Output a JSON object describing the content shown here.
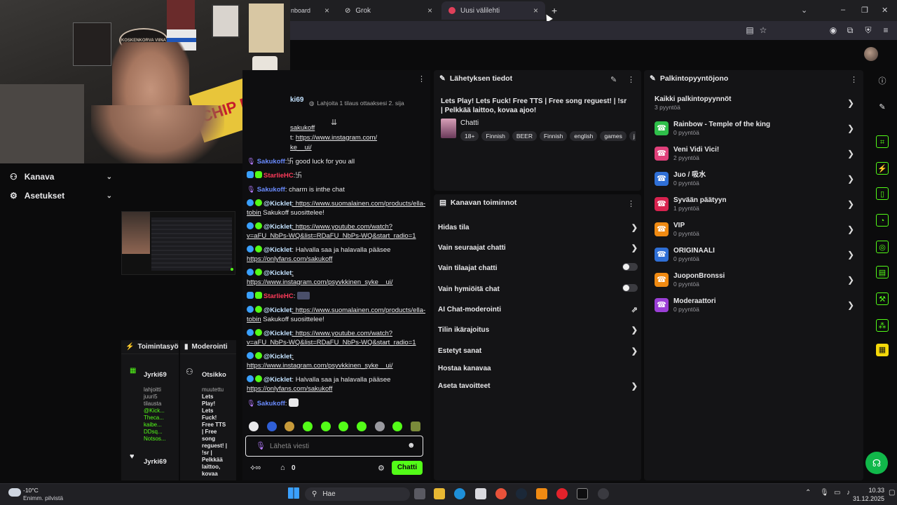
{
  "browser": {
    "tabs": [
      {
        "label": "nboard",
        "close": "×"
      },
      {
        "label": "Grok",
        "close": "×"
      },
      {
        "label": "Uusi välilehti",
        "close": "×"
      }
    ],
    "new_tab": "+"
  },
  "webcam": {
    "poster_text": "KOSKENKORVA VIINA",
    "sign_text": "CHIP DIP"
  },
  "nav": {
    "items": [
      {
        "label": "Kanava",
        "icon": "users-icon"
      },
      {
        "label": "Asetukset",
        "icon": "gear-icon"
      }
    ]
  },
  "panels": {
    "activity": {
      "title": "Toimintasyöte",
      "user": "Jyrki69",
      "lines": [
        "lahjoitti",
        "juuri5",
        "tilausta"
      ],
      "names": [
        "@Kick...",
        "Theca...",
        "kaibe...",
        "DDsq...",
        "Notsos..."
      ],
      "user2": "Jyrki69"
    },
    "moderation": {
      "title": "Moderointi",
      "header": "Otsikko",
      "changed": "muutettu",
      "title_lines": [
        "Lets",
        "Play!",
        "Lets",
        "Fuck!",
        "Free TTS",
        "| Free",
        "song",
        "reguest! |",
        "!sr |",
        "Pelkkää",
        "laittoo,",
        "kovaa"
      ]
    }
  },
  "chat": {
    "top_user": "ki69",
    "gift_hint": "Lahjoita 1 tilaus ottaaksesi 2. sija",
    "messages": [
      {
        "user": "",
        "text": "sakukoff",
        "link": true
      },
      {
        "user": "",
        "prefix": "t:",
        "text": "https://www.instagram.com/",
        "link": true
      },
      {
        "user": "",
        "text": "ke__ui/",
        "link": true
      },
      {
        "user": "Sakukoff",
        "text": ":卐 good luck for you all"
      },
      {
        "user": "StarlieHC",
        "text": ":卐"
      },
      {
        "user": "Sakukoff",
        "text": ": charm is inthe chat"
      },
      {
        "user": "@Kicklet",
        "text": ": https://www.suomalainen.com/products/ella-tobin",
        "after": " Sakukoff suosittelee!"
      },
      {
        "user": "@Kicklet",
        "text": ": https://www.youtube.com/watch?v=aFU_NbPs-WQ&list=RDaFU_NbPs-WQ&start_radio=1"
      },
      {
        "user": "@Kicklet",
        "text": ": Halvalla saa ja halavalla pääsee ",
        "link_text": "https://onlyfans.com/sakukoff"
      },
      {
        "user": "@Kicklet",
        "text": ": https://www.instagram.com/psyvkkinen_syke__ui/"
      },
      {
        "user": "StarlieHC",
        "text": ":"
      },
      {
        "user": "@Kicklet",
        "text": ": https://www.suomalainen.com/products/ella-tobin",
        "after": " Sakukoff suosittelee!"
      },
      {
        "user": "@Kicklet",
        "text": ": https://www.youtube.com/watch?v=aFU_NbPs-WQ&list=RDaFU_NbPs-WQ&start_radio=1"
      },
      {
        "user": "@Kicklet",
        "text": ": https://www.instagram.com/psyvkkinen_syke__ui/"
      },
      {
        "user": "@Kicklet",
        "text": ": Halvalla saa ja halavalla pääsee ",
        "link_text": "https://onlyfans.com/sakukoff"
      },
      {
        "user": "Sakukoff",
        "text": ":"
      }
    ],
    "input_placeholder": "Lähetä viesti",
    "points": "0",
    "send_label": "Chatti"
  },
  "stream_info": {
    "title": "Lähetyksen tiedot",
    "stream_title": "Lets Play! Lets Fuck! Free TTS | Free song reguest! | !sr | Pelkkää laittoo, kovaa ajoo!",
    "category": "Chatti",
    "tags": [
      "18+",
      "Finnish",
      "BEER",
      "Finnish",
      "english",
      "games",
      "j"
    ]
  },
  "channel_actions": {
    "title": "Kanavan toiminnot",
    "items": [
      {
        "label": "Hidas tila",
        "control": "chevron"
      },
      {
        "label": "Vain seuraajat chatti",
        "control": "chevron"
      },
      {
        "label": "Vain tilaajat chatti",
        "control": "toggle"
      },
      {
        "label": "Vain hymiöitä chat",
        "control": "toggle"
      },
      {
        "label": "AI Chat-moderointi",
        "control": "external"
      },
      {
        "label": "Tilin ikärajoitus",
        "control": "chevron"
      },
      {
        "label": "Estetyt sanat",
        "control": "chevron"
      },
      {
        "label": "Hostaa kanavaa",
        "control": "none"
      },
      {
        "label": "Aseta tavoitteet",
        "control": "chevron"
      }
    ]
  },
  "rewards": {
    "title": "Palkintopyyntöjono",
    "all_label": "Kaikki palkintopyynnöt",
    "all_count": "3 pyyntöä",
    "items": [
      {
        "name": "Rainbow - Temple of the king",
        "count": "0 pyyntöä",
        "color": "#2fbf4a"
      },
      {
        "name": "Veni Vidi Vici!",
        "count": "2 pyyntöä",
        "color": "#e0407a"
      },
      {
        "name": "Juo / 吸水",
        "count": "0 pyyntöä",
        "color": "#2f6fd6"
      },
      {
        "name": "Syvään päätyyn",
        "count": "1 pyyntöä",
        "color": "#d8234f"
      },
      {
        "name": "VIP",
        "count": "0 pyyntöä",
        "color": "#f08a12"
      },
      {
        "name": "ORIGINAALI",
        "count": "0 pyyntöä",
        "color": "#2f6fd6"
      },
      {
        "name": "JuoponBronssi",
        "count": "0 pyyntöä",
        "color": "#f08a12"
      },
      {
        "name": "Moderaattori",
        "count": "0 pyyntöä",
        "color": "#9b3fd6"
      }
    ]
  },
  "taskbar": {
    "weather_temp": "-10°C",
    "weather_desc": "Enimm. pilvistä",
    "search": "Hae",
    "time": "10.33",
    "date": "31.12.2025"
  },
  "colors": {
    "accent": "#53fc18",
    "bg": "#0b0b0c",
    "card": "#141416"
  }
}
